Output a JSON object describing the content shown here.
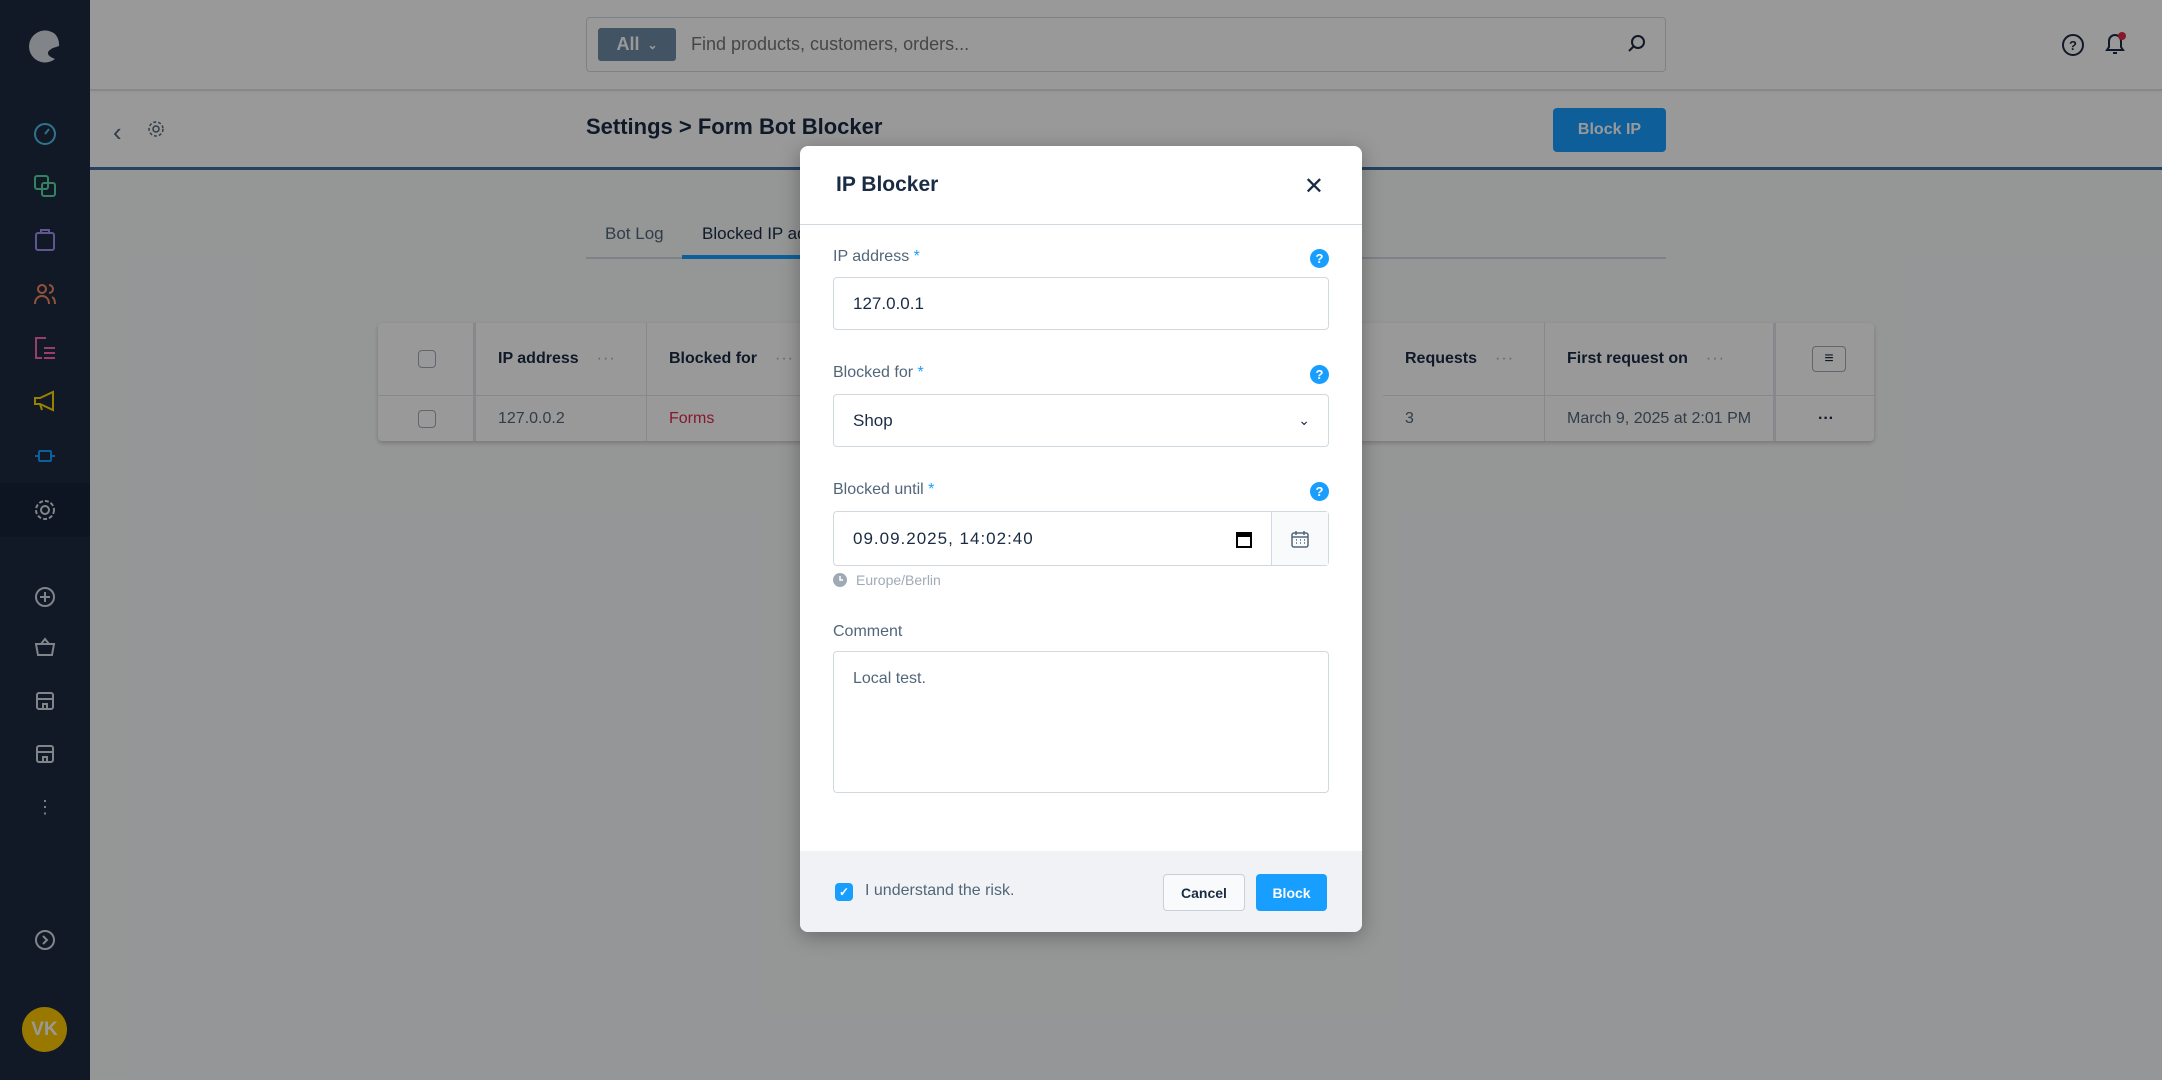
{
  "search": {
    "scope": "All",
    "placeholder": "Find products, customers, orders..."
  },
  "page": {
    "title": "Settings > Form Bot Blocker",
    "block_ip_label": "Block IP"
  },
  "tabs": [
    {
      "label": "Bot Log"
    },
    {
      "label": "Blocked IP ad"
    }
  ],
  "sidebar": {
    "avatar_initials": "VK",
    "icons": [
      "dashboard-icon",
      "catalogue-icon",
      "orders-icon",
      "customers-icon",
      "content-icon",
      "marketing-icon",
      "extensions-icon",
      "settings-icon",
      "add-icon",
      "basket-icon",
      "storefront-icon",
      "storefront-icon",
      "more-icon",
      "expand-icon"
    ]
  },
  "table": {
    "columns": [
      "IP address",
      "Blocked for",
      "Requests",
      "First request on"
    ],
    "rows": [
      {
        "ip": "127.0.0.2",
        "blocked_for": "Forms",
        "requests": "3",
        "first_request": "March 9, 2025 at 2:01 PM",
        "actions": "···"
      }
    ]
  },
  "modal": {
    "title": "IP Blocker",
    "ip_label": "IP address",
    "ip_value": "127.0.0.1",
    "blocked_for_label": "Blocked for",
    "blocked_for_value": "Shop",
    "blocked_until_label": "Blocked until",
    "blocked_until_value": "09.09.2025, 14:02:40",
    "timezone": "Europe/Berlin",
    "comment_label": "Comment",
    "comment_value": "Local test.",
    "required_mark": "*",
    "risk_label": "I understand the risk.",
    "risk_checked": true,
    "cancel_label": "Cancel",
    "block_label": "Block"
  },
  "colors": {
    "accent": "#189eff",
    "sidebar": "#1d2a40",
    "forms_link": "#de294c"
  }
}
